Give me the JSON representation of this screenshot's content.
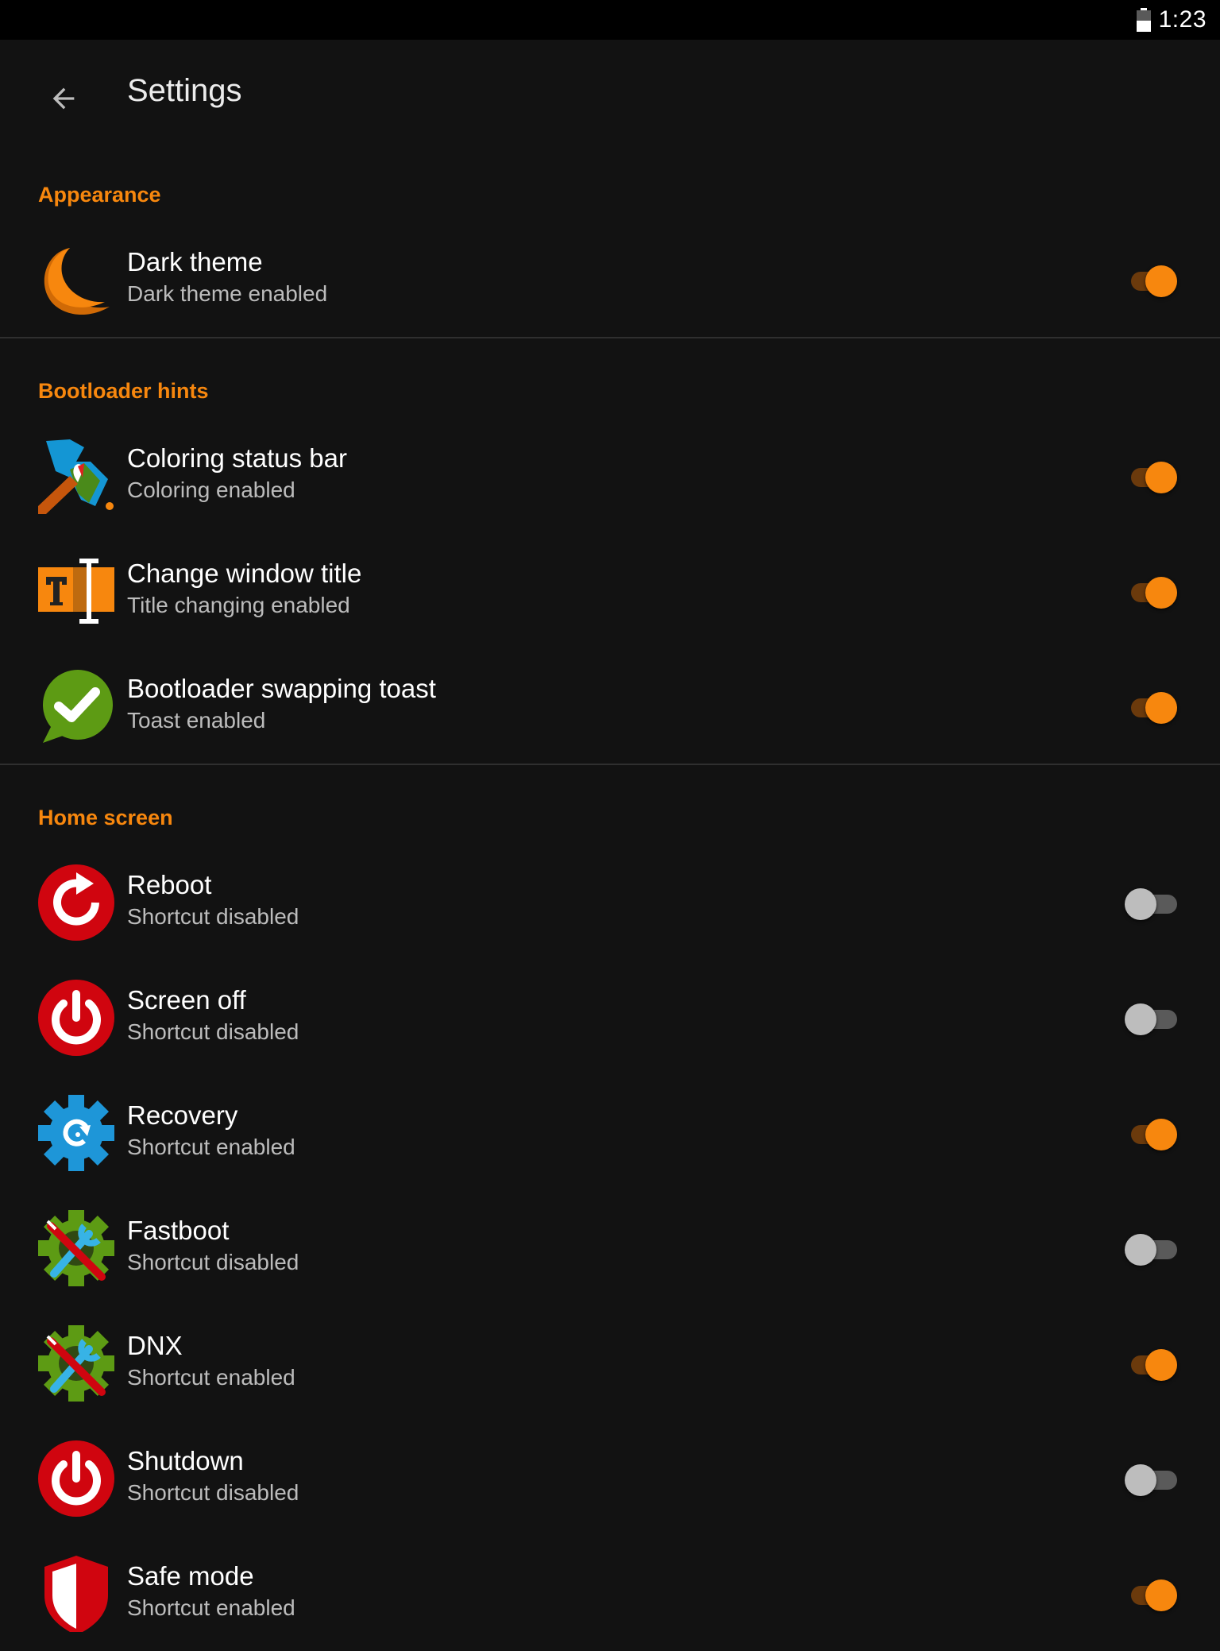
{
  "status_bar": {
    "time": "1:23",
    "battery_icon": "battery-icon"
  },
  "app_bar": {
    "title": "Settings",
    "back_icon": "arrow-back-icon"
  },
  "colors": {
    "accent": "#f7870e",
    "background": "#121212",
    "divider": "#2f2f2f"
  },
  "sections": [
    {
      "header": "Appearance",
      "items": [
        {
          "title": "Dark theme",
          "summary": "Dark theme enabled",
          "icon": "moon-icon",
          "enabled": true
        }
      ]
    },
    {
      "header": "Bootloader hints",
      "items": [
        {
          "title": "Coloring status bar",
          "summary": "Coloring enabled",
          "icon": "paint-brush-icon",
          "enabled": true
        },
        {
          "title": "Change window title",
          "summary": "Title changing enabled",
          "icon": "text-cursor-icon",
          "enabled": true
        },
        {
          "title": "Bootloader swapping toast",
          "summary": "Toast enabled",
          "icon": "check-bubble-icon",
          "enabled": true
        }
      ]
    },
    {
      "header": "Home screen",
      "items": [
        {
          "title": "Reboot",
          "summary": "Shortcut disabled",
          "icon": "reboot-icon",
          "enabled": false
        },
        {
          "title": "Screen off",
          "summary": "Shortcut disabled",
          "icon": "power-icon",
          "enabled": false
        },
        {
          "title": "Recovery",
          "summary": "Shortcut enabled",
          "icon": "recovery-gear-icon",
          "enabled": true
        },
        {
          "title": "Fastboot",
          "summary": "Shortcut disabled",
          "icon": "tools-gear-icon",
          "enabled": false
        },
        {
          "title": "DNX",
          "summary": "Shortcut enabled",
          "icon": "tools-gear-icon",
          "enabled": true
        },
        {
          "title": "Shutdown",
          "summary": "Shortcut disabled",
          "icon": "power-icon",
          "enabled": false
        },
        {
          "title": "Safe mode",
          "summary": "Shortcut enabled",
          "icon": "shield-icon",
          "enabled": true
        }
      ]
    }
  ]
}
